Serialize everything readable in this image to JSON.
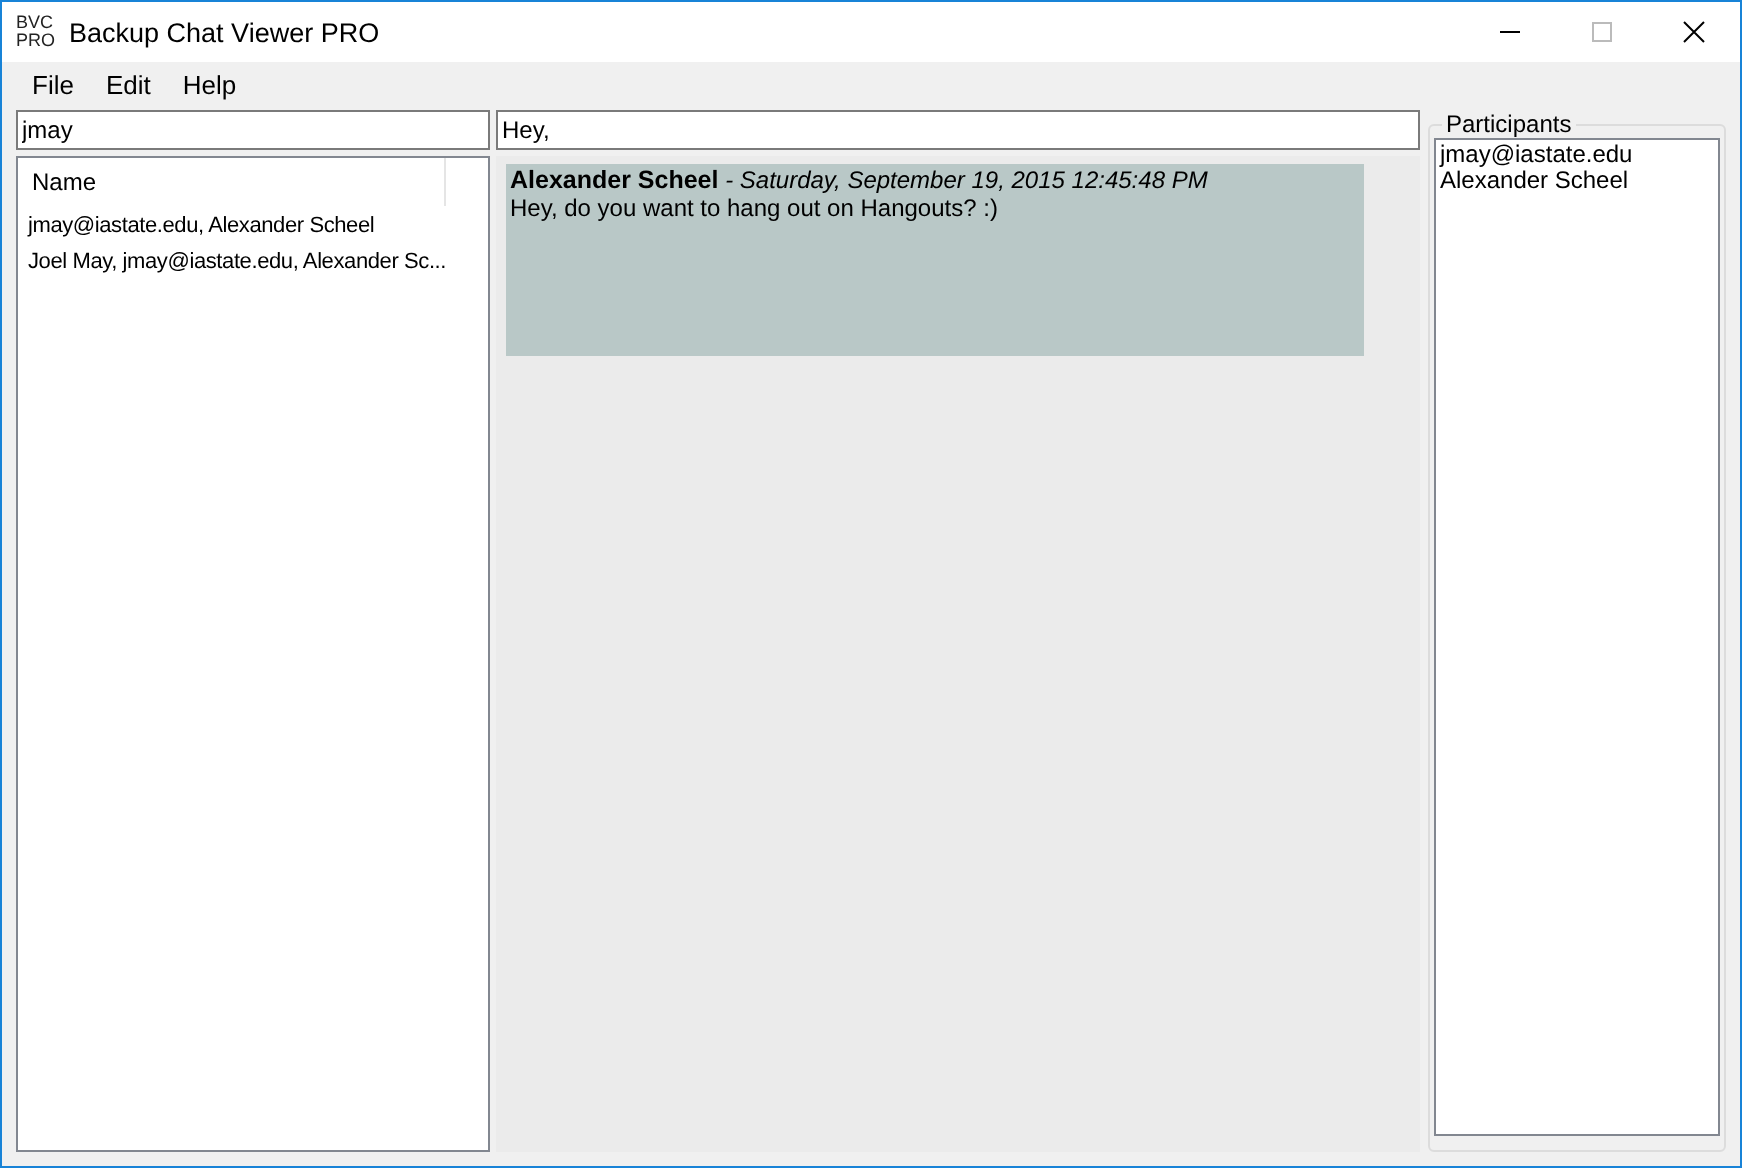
{
  "window": {
    "logo_top": "BVC",
    "logo_bottom": "PRO",
    "title": "Backup Chat Viewer PRO"
  },
  "menu": [
    "File",
    "Edit",
    "Help"
  ],
  "search": {
    "value": "jmay"
  },
  "conversations": {
    "columns": [
      "Name"
    ],
    "rows": [
      {
        "name": "jmay@iastate.edu, Alexander Scheel",
        "selected": false
      },
      {
        "name": "Joel May, jmay@iastate.edu, Alexander Sc...",
        "selected": false
      }
    ]
  },
  "message_search": {
    "value": "Hey,"
  },
  "messages": [
    {
      "sender": "Alexander Scheel",
      "time": "- Saturday, September 19, 2015 12:45:48 PM",
      "text": "Hey, do you want to hang out on Hangouts? :)"
    }
  ],
  "participants": {
    "title": "Participants",
    "items": [
      "jmay@iastate.edu",
      "Alexander Scheel"
    ]
  }
}
